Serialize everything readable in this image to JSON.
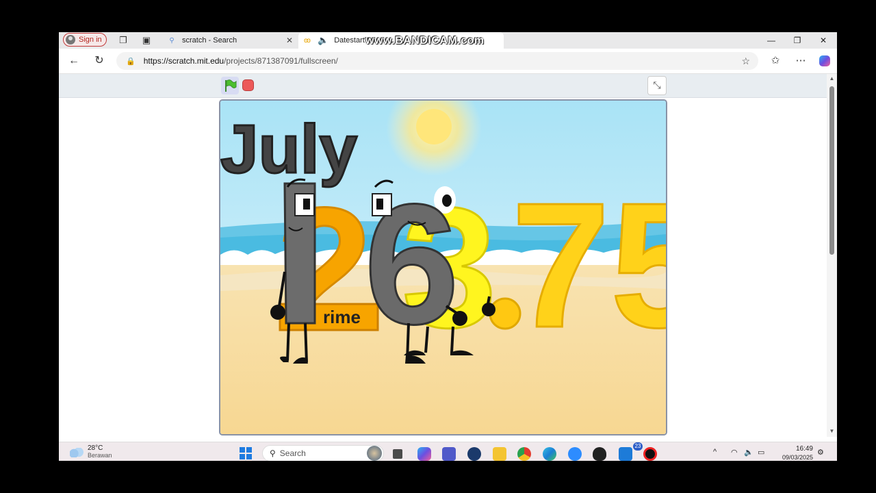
{
  "browser": {
    "signin_label": "Sign in",
    "tabs": [
      {
        "title": "scratch - Search",
        "icon": "search-icon"
      },
      {
        "title": "Datestart Ba",
        "icon": "scratch-favicon",
        "audio_icon": "speaker-icon"
      }
    ],
    "url_host": "https://scratch.mit.edu",
    "url_path": "/projects/871387091/fullscreen/"
  },
  "watermark": "www.BANDICAM.com",
  "stage": {
    "month": "July",
    "number_front": "16",
    "number_back": "23",
    "decimal": ".75",
    "badge_label": "rime",
    "colors": {
      "sky": "#c9ecf8",
      "sand": "#f6dca1",
      "gray": "#707070",
      "orange": "#f7a400",
      "yellow": "#ffe100"
    }
  },
  "taskbar": {
    "temperature": "28°C",
    "condition": "Berawan",
    "search_placeholder": "Search",
    "mail_badge": "23",
    "time": "16:49",
    "date": "09/03/2025"
  }
}
